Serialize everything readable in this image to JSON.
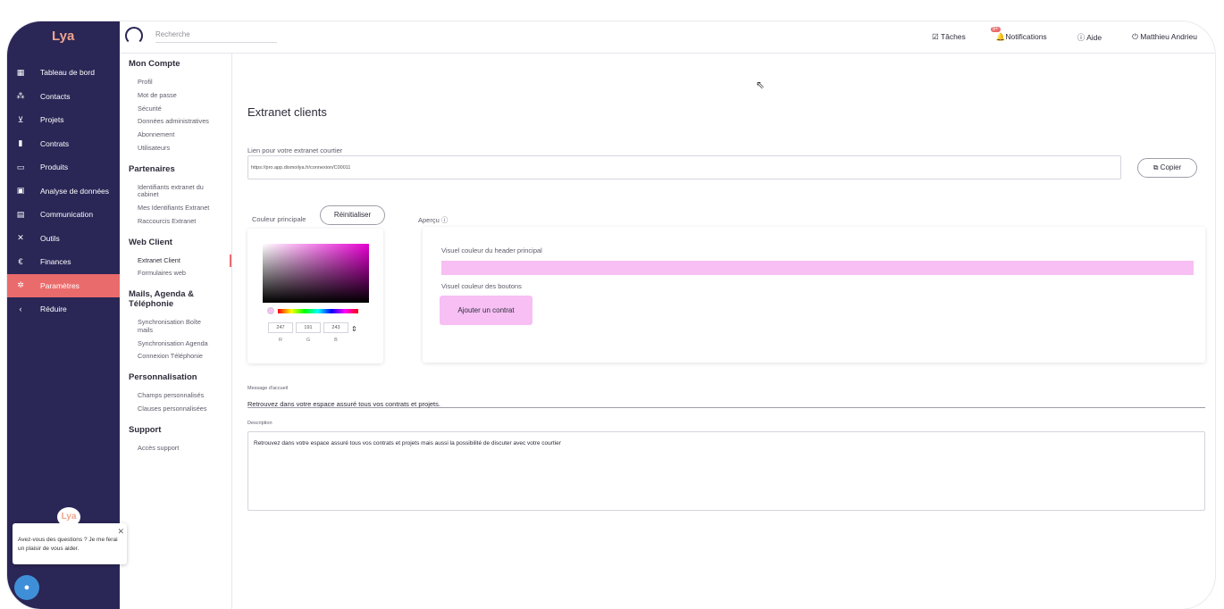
{
  "app": {
    "logo": "Lya"
  },
  "sidebar": {
    "items": [
      {
        "label": "Tableau de bord",
        "icon": "dashboard-icon",
        "glyph": "▦"
      },
      {
        "label": "Contacts",
        "icon": "people-icon",
        "glyph": "👥"
      },
      {
        "label": "Projets",
        "icon": "cart-icon",
        "glyph": "🛒"
      },
      {
        "label": "Contrats",
        "icon": "document-icon",
        "glyph": "🗎"
      },
      {
        "label": "Produits",
        "icon": "shop-icon",
        "glyph": "▤"
      },
      {
        "label": "Analyse de données",
        "icon": "chart-icon",
        "glyph": "📊"
      },
      {
        "label": "Communication",
        "icon": "message-icon",
        "glyph": "▤"
      },
      {
        "label": "Outils",
        "icon": "tools-icon",
        "glyph": "✕"
      },
      {
        "label": "Finances",
        "icon": "euro-icon",
        "glyph": "€"
      },
      {
        "label": "Paramètres",
        "icon": "gear-icon",
        "glyph": "✲"
      },
      {
        "label": "Réduire",
        "icon": "chevron-left-icon",
        "glyph": "‹"
      }
    ]
  },
  "chat": {
    "text": "Avez-vous des questions ? Je me ferai un plaisir de vous aider."
  },
  "topbar": {
    "search_placeholder": "Recherche",
    "tasks": "Tâches",
    "notifications": "Notifications",
    "notifications_badge": "9+",
    "help": "Aide",
    "user": "Matthieu Andrieu"
  },
  "submenu": {
    "sections": [
      {
        "title": "Mon Compte",
        "items": [
          "Profil",
          "Mot de passe",
          "Sécurité",
          "Données administratives",
          "Abonnement",
          "Utilisateurs"
        ]
      },
      {
        "title": "Partenaires",
        "items": [
          "Identifiants extranet du cabinet",
          "Mes Identifiants Extranet",
          "Raccourcis Extranet"
        ]
      },
      {
        "title": "Web Client",
        "items": [
          "Extranet Client",
          "Formulaires web"
        ]
      },
      {
        "title": "Mails, Agenda & Téléphonie",
        "items": [
          "Synchronisation Boîte mails",
          "Synchronisation Agenda",
          "Connexion Téléphonie"
        ]
      },
      {
        "title": "Personnalisation",
        "items": [
          "Champs personnalisés",
          "Clauses personnalisées"
        ]
      },
      {
        "title": "Support",
        "items": [
          "Accès support"
        ]
      }
    ]
  },
  "main": {
    "title": "Extranet clients",
    "link_label": "Lien pour votre extranet courtier",
    "link_value": "https://pro.app.dismoilya.fr/connexion/C00011",
    "copy_label": "Copier",
    "color_label": "Couleur principale",
    "reset_label": "Réinitialiser",
    "preview_label": "Aperçu",
    "rgb": {
      "r": "247",
      "g": "191",
      "b": "243"
    },
    "rgb_labels": {
      "r": "R",
      "g": "G",
      "b": "B"
    },
    "header_visual_label": "Visuel couleur du header principal",
    "buttons_visual_label": "Visuel couleur des boutons",
    "add_contract": "Ajouter un contrat",
    "welcome_label": "Message d'accueil",
    "welcome_value": "Retrouvez dans votre espace assuré tous vos contrats et projets.",
    "description_label": "Description",
    "description_value": "Retrouvez dans votre espace assuré tous vos contrats et projets mais aussi la possibilité de discuter avec votre courtier"
  },
  "colors": {
    "sidebar": "#2a2656",
    "accent": "#ea6b6b",
    "preview": "#f7bff3"
  }
}
